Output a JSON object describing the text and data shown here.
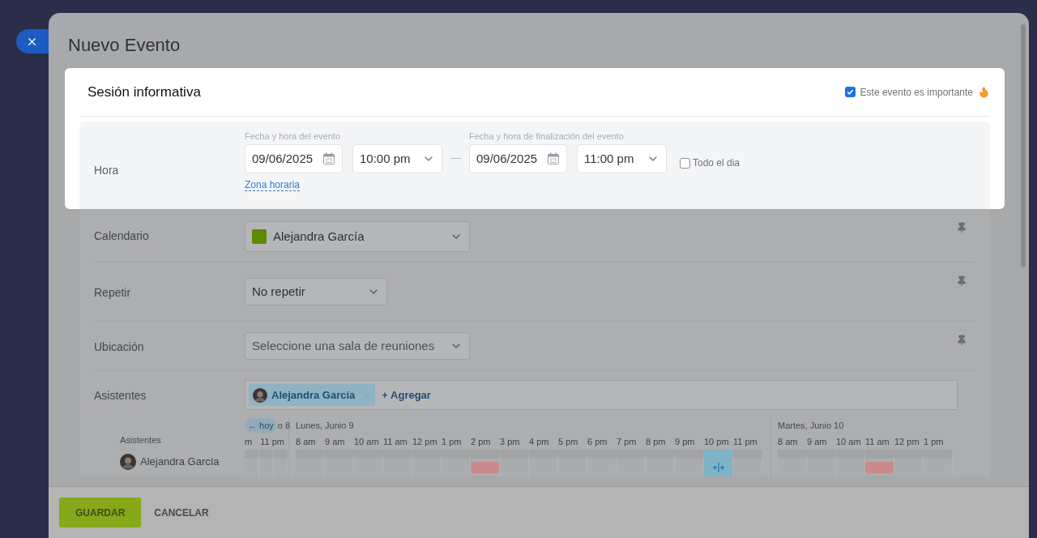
{
  "dialog": {
    "title": "Nuevo Evento"
  },
  "event": {
    "name": "Sesión informativa",
    "important": {
      "label": "Este evento es importante",
      "checked": true
    }
  },
  "time": {
    "label": "Hora",
    "start": {
      "caption": "Fecha y hora del evento",
      "date": "09/06/2025",
      "time": "10:00 pm"
    },
    "separator": "—",
    "end": {
      "caption": "Fecha y hora de finalización del evento",
      "date": "09/06/2025",
      "time": "11:00 pm"
    },
    "all_day": {
      "label": "Todo el dia",
      "checked": false
    },
    "timezone_link": "Zona horaria"
  },
  "rows": [
    {
      "kind": "calendar",
      "label": "Calendario",
      "value": "Alejandra García",
      "color": "#5c8a00",
      "pinned": true
    },
    {
      "kind": "select",
      "label": "Repetir",
      "value": "No repetir",
      "pinned": true
    },
    {
      "kind": "placeholder",
      "label": "Ubicación",
      "value": "Seleccione una sala de reuniones",
      "pinned": true
    }
  ],
  "attendees": {
    "label": "Asistentes",
    "people": [
      {
        "name": "Alejandra García"
      }
    ],
    "add_label": "+ Agregar"
  },
  "timeline": {
    "today_button": "← hoy",
    "prev_day": "o 8",
    "prev_hours": [
      "m",
      "11 pm"
    ],
    "row_label": "Asistentes",
    "attendees": [
      {
        "name": "Alejandra García"
      }
    ],
    "days": [
      {
        "title": "Lunes, Junio 9",
        "hours": [
          {
            "label": "8 am",
            "busy": false,
            "selected": false
          },
          {
            "label": "9 am",
            "busy": false,
            "selected": false
          },
          {
            "label": "10 am",
            "busy": false,
            "selected": false
          },
          {
            "label": "11 am",
            "busy": false,
            "selected": false
          },
          {
            "label": "12 pm",
            "busy": false,
            "selected": false
          },
          {
            "label": "1 pm",
            "busy": false,
            "selected": false
          },
          {
            "label": "2 pm",
            "busy": true,
            "selected": false
          },
          {
            "label": "3 pm",
            "busy": false,
            "selected": false
          },
          {
            "label": "4 pm",
            "busy": false,
            "selected": false
          },
          {
            "label": "5 pm",
            "busy": false,
            "selected": false
          },
          {
            "label": "6 pm",
            "busy": false,
            "selected": false
          },
          {
            "label": "7 pm",
            "busy": false,
            "selected": false
          },
          {
            "label": "8 pm",
            "busy": false,
            "selected": false
          },
          {
            "label": "9 pm",
            "busy": false,
            "selected": false
          },
          {
            "label": "10 pm",
            "busy": false,
            "selected": true
          },
          {
            "label": "11 pm",
            "busy": false,
            "selected": false
          }
        ]
      },
      {
        "title": "Martes, Junio 10",
        "hours": [
          {
            "label": "8 am",
            "busy": false,
            "selected": false
          },
          {
            "label": "9 am",
            "busy": false,
            "selected": false
          },
          {
            "label": "10 am",
            "busy": false,
            "selected": false
          },
          {
            "label": "11 am",
            "busy": true,
            "selected": false
          },
          {
            "label": "12 pm",
            "busy": false,
            "selected": false
          },
          {
            "label": "1 pm",
            "busy": false,
            "selected": false
          }
        ]
      }
    ]
  },
  "footer": {
    "buttons": [
      {
        "label": "GUARDAR",
        "kind": "primary"
      },
      {
        "label": "CANCELAR",
        "kind": "link"
      }
    ]
  }
}
